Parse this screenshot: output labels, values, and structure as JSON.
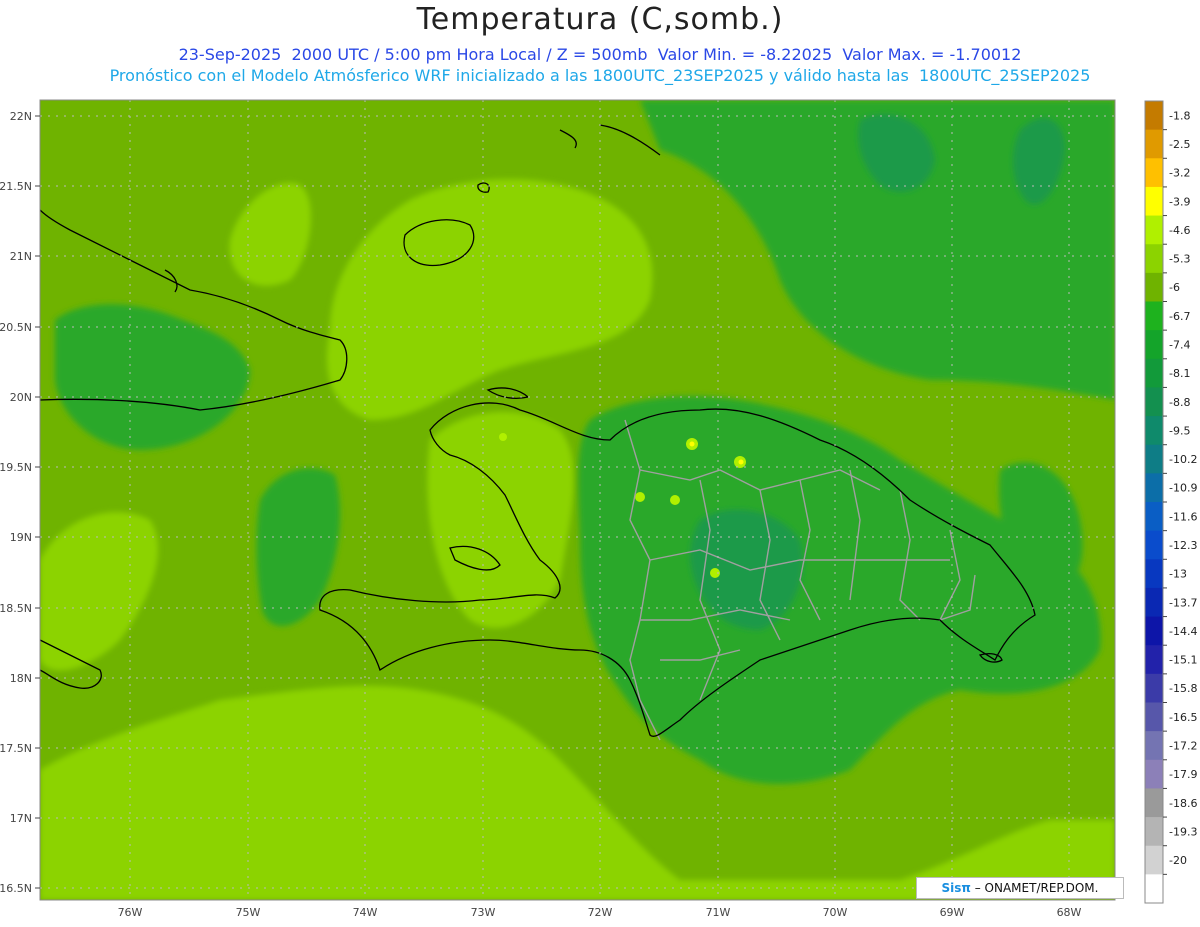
{
  "header": {
    "title": "Temperatura (C,somb.)",
    "line1": "23-Sep-2025  2000 UTC / 5:00 pm Hora Local / Z = 500mb  Valor Min. = -8.22025  Valor Max. = -1.70012",
    "line2": "Pronóstico con el Modelo Atmósferico WRF inicializado a las 1800UTC_23SEP2025 y válido hasta las  1800UTC_25SEP2025"
  },
  "map": {
    "lat_labels": [
      "22N",
      "21.5N",
      "21N",
      "20.5N",
      "20N",
      "19.5N",
      "19N",
      "18.5N",
      "18N",
      "17.5N",
      "17N",
      "16.5N"
    ],
    "lon_labels": [
      "76W",
      "75W",
      "74W",
      "73W",
      "72W",
      "71W",
      "70W",
      "69W",
      "68W"
    ],
    "colors": {
      "background_field": "#6fb300",
      "light_field": "#8cd300",
      "dark_field": "#2aa82a",
      "darker_field": "#1f9a4a",
      "coastline": "#000000",
      "provinces": "#a0a0a0",
      "grid": "#bbbbbb"
    }
  },
  "colorbar": {
    "labels": [
      "-1.8",
      "-2.5",
      "-3.2",
      "-3.9",
      "-4.6",
      "-5.3",
      "-6",
      "-6.7",
      "-7.4",
      "-8.1",
      "-8.8",
      "-9.5",
      "-10.2",
      "-10.9",
      "-11.6",
      "-12.3",
      "-13",
      "-13.7",
      "-14.4",
      "-15.1",
      "-15.8",
      "-16.5",
      "-17.2",
      "-17.9",
      "-18.6",
      "-19.3",
      "-20"
    ],
    "colors": [
      "#c47b00",
      "#e09a00",
      "#ffc000",
      "#ffff00",
      "#b0f000",
      "#8cd300",
      "#6fb300",
      "#1eb21e",
      "#14a42a",
      "#129a3a",
      "#13904f",
      "#0f8a6b",
      "#0e7d86",
      "#0c6ea8",
      "#0a5ec5",
      "#0a4ccc",
      "#0838c0",
      "#0a28b3",
      "#0d15a8",
      "#2222aa",
      "#3b3ba8",
      "#5757aa",
      "#7474b2",
      "#8c80b8",
      "#9a9a9a",
      "#b4b4b4",
      "#d2d2d2",
      "#ffffff"
    ]
  },
  "credit": {
    "sis": "Sisπ",
    "text": " – ONAMET/REP.DOM."
  }
}
